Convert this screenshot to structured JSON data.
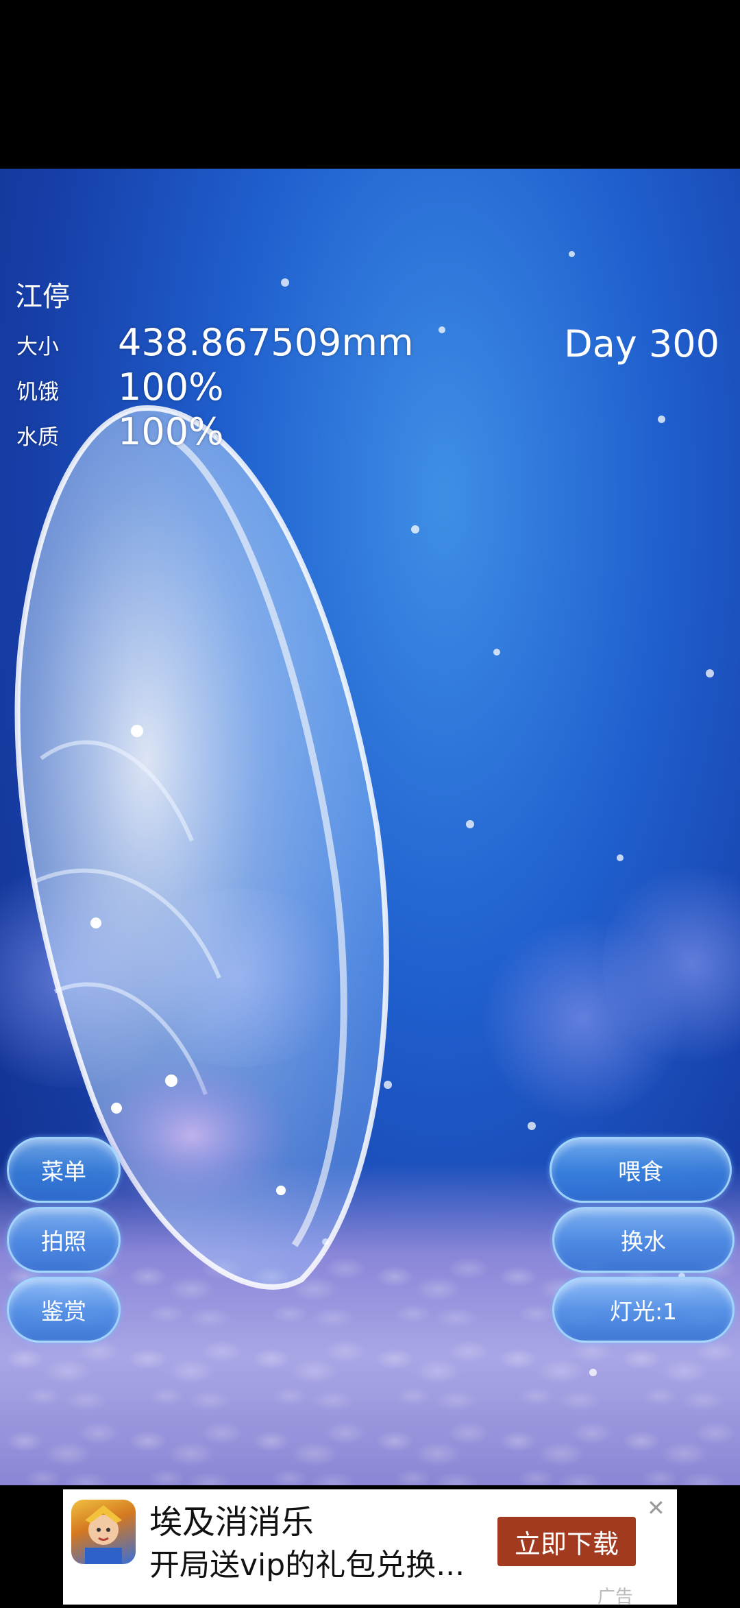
{
  "pet": {
    "name": "江停",
    "stats": [
      {
        "label": "大小",
        "value": "438.867509mm"
      },
      {
        "label": "饥饿",
        "value": "100%"
      },
      {
        "label": "水质",
        "value": "100%"
      }
    ],
    "day": "Day 300"
  },
  "buttons": {
    "left": [
      "菜单",
      "拍照",
      "鉴赏"
    ],
    "right": [
      "喂食",
      "换水",
      "灯光:1"
    ]
  },
  "ad": {
    "title": "埃及消消乐",
    "subtitle": "开局送vip的礼包兑换...",
    "cta": "立即下载",
    "close_icon": "close-icon",
    "tag": "广告"
  },
  "colors": {
    "water": "#1f5fce",
    "button": "#4a9be8",
    "ad_cta": "#a23a1f"
  }
}
